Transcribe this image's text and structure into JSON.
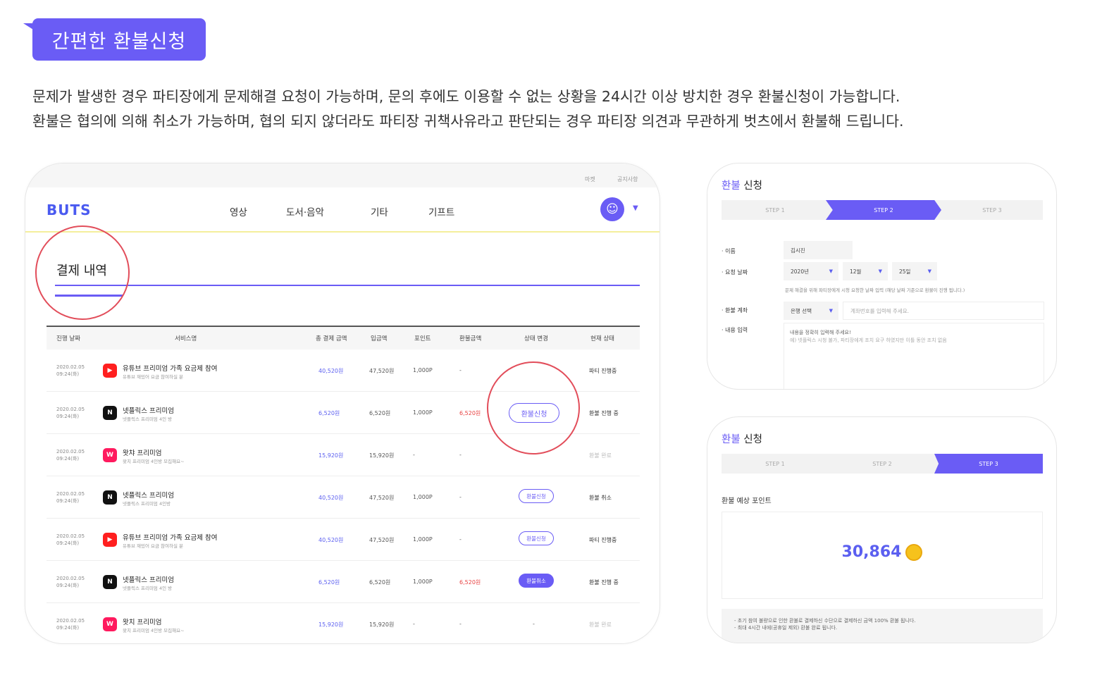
{
  "header": {
    "badge": "간편한 환불신청",
    "desc_line1": "문제가 발생한 경우 파티장에게 문제해결 요청이 가능하며, 문의 후에도 이용할 수 없는 상황을 24시간 이상 방치한 경우 환불신청이 가능합니다.",
    "desc_line2": "환불은 협의에 의해 취소가 가능하며, 협의 되지 않더라도 파티장 귀책사유라고 판단되는 경우 파티장 의견과 무관하게 벗츠에서 환불해 드립니다."
  },
  "mock": {
    "topbar": [
      "마켓",
      "공지사항"
    ],
    "logo": "BUTS",
    "nav": [
      "영상",
      "도서·음악",
      "기타",
      "기프트"
    ],
    "section_title": "결제 내역",
    "columns": [
      "진행 날짜",
      "서비스명",
      "총 결제 금액",
      "입금액",
      "포인트",
      "환불금액",
      "상태 변경",
      "현재 상태"
    ],
    "rows": [
      {
        "date1": "2020.02.05",
        "date2": "09:24(화)",
        "icon": "youtube-icon",
        "icon_char": "▶",
        "icon_color": "#ff1f1f",
        "name": "유튜브 프리미엄 가족 요금제 참여",
        "sub": "유튜브 재밌어 요금 참여하실 분",
        "total": "40,520원",
        "paid": "47,520원",
        "point": "1,000P",
        "refund": "-",
        "refund_red": false,
        "action": "",
        "action_style": "none",
        "status": "파티 진행중",
        "status_dim": false
      },
      {
        "date1": "2020.02.05",
        "date2": "09:24(화)",
        "icon": "netflix-icon",
        "icon_char": "N",
        "icon_color": "#111111",
        "name": "넷플릭스 프리미엄",
        "sub": "넷플릭스 프리미엄 4인 방",
        "total": "6,520원",
        "paid": "6,520원",
        "point": "1,000P",
        "refund": "6,520원",
        "refund_red": true,
        "action": "환불신청",
        "action_style": "big",
        "status": "환불 진행 중",
        "status_dim": false
      },
      {
        "date1": "2020.02.05",
        "date2": "09:24(화)",
        "icon": "watcha-icon",
        "icon_char": "W",
        "icon_color": "#ff1a5e",
        "name": "왓챠 프리미엄",
        "sub": "왓치 프리미엄 4인방 모집해요~",
        "total": "15,920원",
        "paid": "15,920원",
        "point": "-",
        "refund": "-",
        "refund_red": false,
        "action": "",
        "action_style": "none",
        "status": "환불 완료",
        "status_dim": true
      },
      {
        "date1": "2020.02.05",
        "date2": "09:24(화)",
        "icon": "netflix-icon",
        "icon_char": "N",
        "icon_color": "#111111",
        "name": "넷플릭스 프리미엄",
        "sub": "넷플릭스 프리미엄 4인방",
        "total": "40,520원",
        "paid": "47,520원",
        "point": "1,000P",
        "refund": "-",
        "refund_red": false,
        "action": "환불신청",
        "action_style": "outline",
        "status": "환불 취소",
        "status_dim": false
      },
      {
        "date1": "2020.02.05",
        "date2": "09:24(화)",
        "icon": "youtube-icon",
        "icon_char": "▶",
        "icon_color": "#ff1f1f",
        "name": "유튜브 프리미엄 가족 요금제 참여",
        "sub": "유튜브 재밌어 요금 참여하실 분",
        "total": "40,520원",
        "paid": "47,520원",
        "point": "1,000P",
        "refund": "-",
        "refund_red": false,
        "action": "환불신청",
        "action_style": "outline",
        "status": "파티 진행중",
        "status_dim": false
      },
      {
        "date1": "2020.02.05",
        "date2": "09:24(화)",
        "icon": "netflix-icon",
        "icon_char": "N",
        "icon_color": "#111111",
        "name": "넷플릭스 프리미엄",
        "sub": "넷플릭스 프리미엄 4인 방",
        "total": "6,520원",
        "paid": "6,520원",
        "point": "1,000P",
        "refund": "6,520원",
        "refund_red": true,
        "action": "환불취소",
        "action_style": "filled",
        "status": "환불 진행 중",
        "status_dim": false
      },
      {
        "date1": "2020.02.05",
        "date2": "09:24(화)",
        "icon": "watcha-icon",
        "icon_char": "W",
        "icon_color": "#ff1a5e",
        "name": "왓치 프리미엄",
        "sub": "왓치 프리미엄 4인방 모집해요~",
        "total": "15,920원",
        "paid": "15,920원",
        "point": "-",
        "refund": "-",
        "refund_red": false,
        "action": "-",
        "action_style": "text",
        "status": "환불 완료",
        "status_dim": true
      }
    ]
  },
  "card1": {
    "title_hl": "환불",
    "title_rest": " 신청",
    "steps": [
      "STEP 1",
      "STEP 2",
      "STEP 3"
    ],
    "active_step": 2,
    "labels": {
      "name": "· 이름",
      "date": "· 요청 날짜",
      "account": "· 환불 계좌",
      "content": "· 내용 입력"
    },
    "name_value": "김시진",
    "year": "2020년",
    "month": "12월",
    "day": "25일",
    "date_note": "문제 해결을 위해 파티장에게 시청 요청한 날짜 입력 (해당 날짜 기준으로 환불이 진행 됩니다.)",
    "bank_select": "은행 선택",
    "account_placeholder": "계좌번호를 입력해 주세요.",
    "content_line1": "내용을 정확히 입력해 주세요!",
    "content_line2": "예) 넷플릭스 시청 불가, 파티장에게 조치 요구 하였지만 이틀 동안 조치 없음"
  },
  "card2": {
    "title_hl": "환불",
    "title_rest": " 신청",
    "steps": [
      "STEP 1",
      "STEP 2",
      "STEP 3"
    ],
    "active_step": 3,
    "expected_label": "환불 예상 포인트",
    "point_value": "30,864",
    "notice1": "- 초기 참여 불량으로 인한 환불로 결제하신 수단으로 결제하신 금액 100% 환불 됩니다.",
    "notice2": "- 최대 4시간 내에(공휴일 제외) 환불 완료 됩니다."
  },
  "colors": {
    "accent": "#6a5cf5",
    "alert_circle": "#e24d5a",
    "refund_red": "#e84141",
    "coin": "#f6c21c"
  }
}
